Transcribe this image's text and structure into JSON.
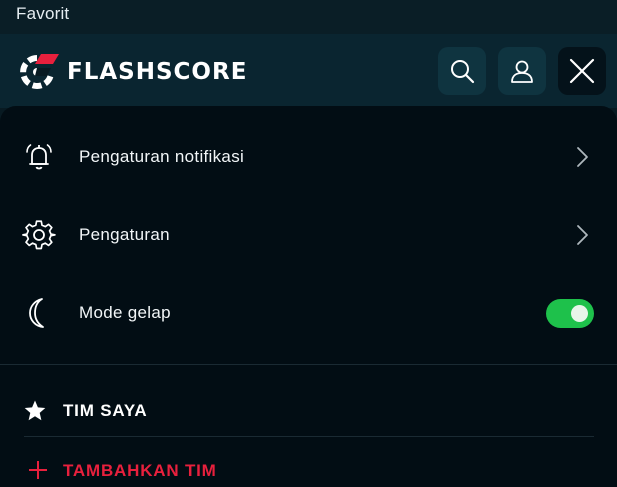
{
  "status_bar": {
    "label": "Favorit"
  },
  "header": {
    "brand": "FLASHSCORE",
    "icons": {
      "search": "search-icon",
      "user": "user-icon",
      "close": "close-icon"
    },
    "colors": {
      "brand_accent": "#e8203d",
      "background": "#0a2530"
    }
  },
  "menu": {
    "items": [
      {
        "label": "Pengaturan notifikasi",
        "icon": "bell-icon",
        "action": "chevron-right-icon"
      },
      {
        "label": "Pengaturan",
        "icon": "gear-icon",
        "action": "chevron-right-icon"
      },
      {
        "label": "Mode gelap",
        "icon": "moon-icon",
        "action": "toggle",
        "toggle_on": true
      }
    ]
  },
  "my_teams": {
    "title": "TIM SAYA",
    "icon": "star-icon",
    "add_label": "TAMBAHKAN TIM",
    "add_icon": "plus-icon"
  },
  "colors": {
    "toggle_on": "#1ec14b",
    "accent_red": "#e8203d",
    "panel_bg": "#020d14"
  }
}
